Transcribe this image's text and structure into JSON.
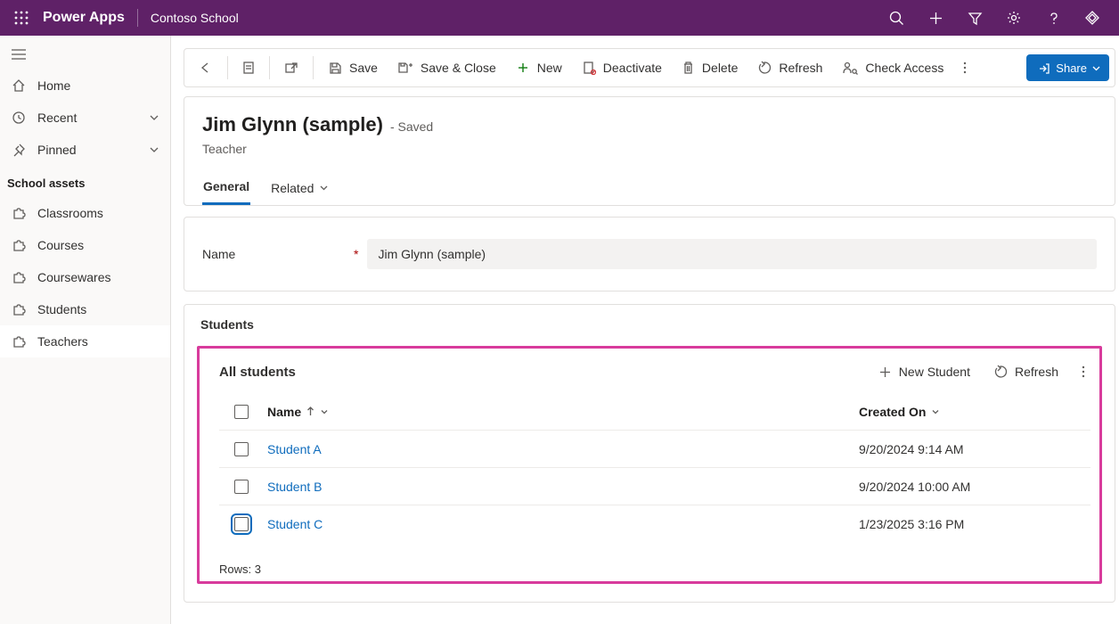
{
  "topbar": {
    "brand": "Power Apps",
    "environment": "Contoso School"
  },
  "sidebar": {
    "home": "Home",
    "recent": "Recent",
    "pinned": "Pinned",
    "group_title": "School assets",
    "items": {
      "classrooms": "Classrooms",
      "courses": "Courses",
      "coursewares": "Coursewares",
      "students": "Students",
      "teachers": "Teachers"
    }
  },
  "commands": {
    "save": "Save",
    "save_close": "Save & Close",
    "new": "New",
    "deactivate": "Deactivate",
    "delete": "Delete",
    "refresh": "Refresh",
    "check_access": "Check Access",
    "share": "Share"
  },
  "record": {
    "title": "Jim Glynn (sample)",
    "saved_suffix": "- Saved",
    "subtype": "Teacher",
    "tabs": {
      "general": "General",
      "related": "Related"
    },
    "name_label": "Name",
    "name_value": "Jim Glynn (sample)"
  },
  "students": {
    "section_title": "Students",
    "subgrid_title": "All students",
    "new_btn": "New Student",
    "refresh_btn": "Refresh",
    "columns": {
      "name": "Name",
      "created": "Created On"
    },
    "rows": [
      {
        "name": "Student A",
        "created": "9/20/2024 9:14 AM"
      },
      {
        "name": "Student B",
        "created": "9/20/2024 10:00 AM"
      },
      {
        "name": "Student C",
        "created": "1/23/2025 3:16 PM"
      }
    ],
    "footer_label": "Rows:",
    "row_count": "3"
  }
}
